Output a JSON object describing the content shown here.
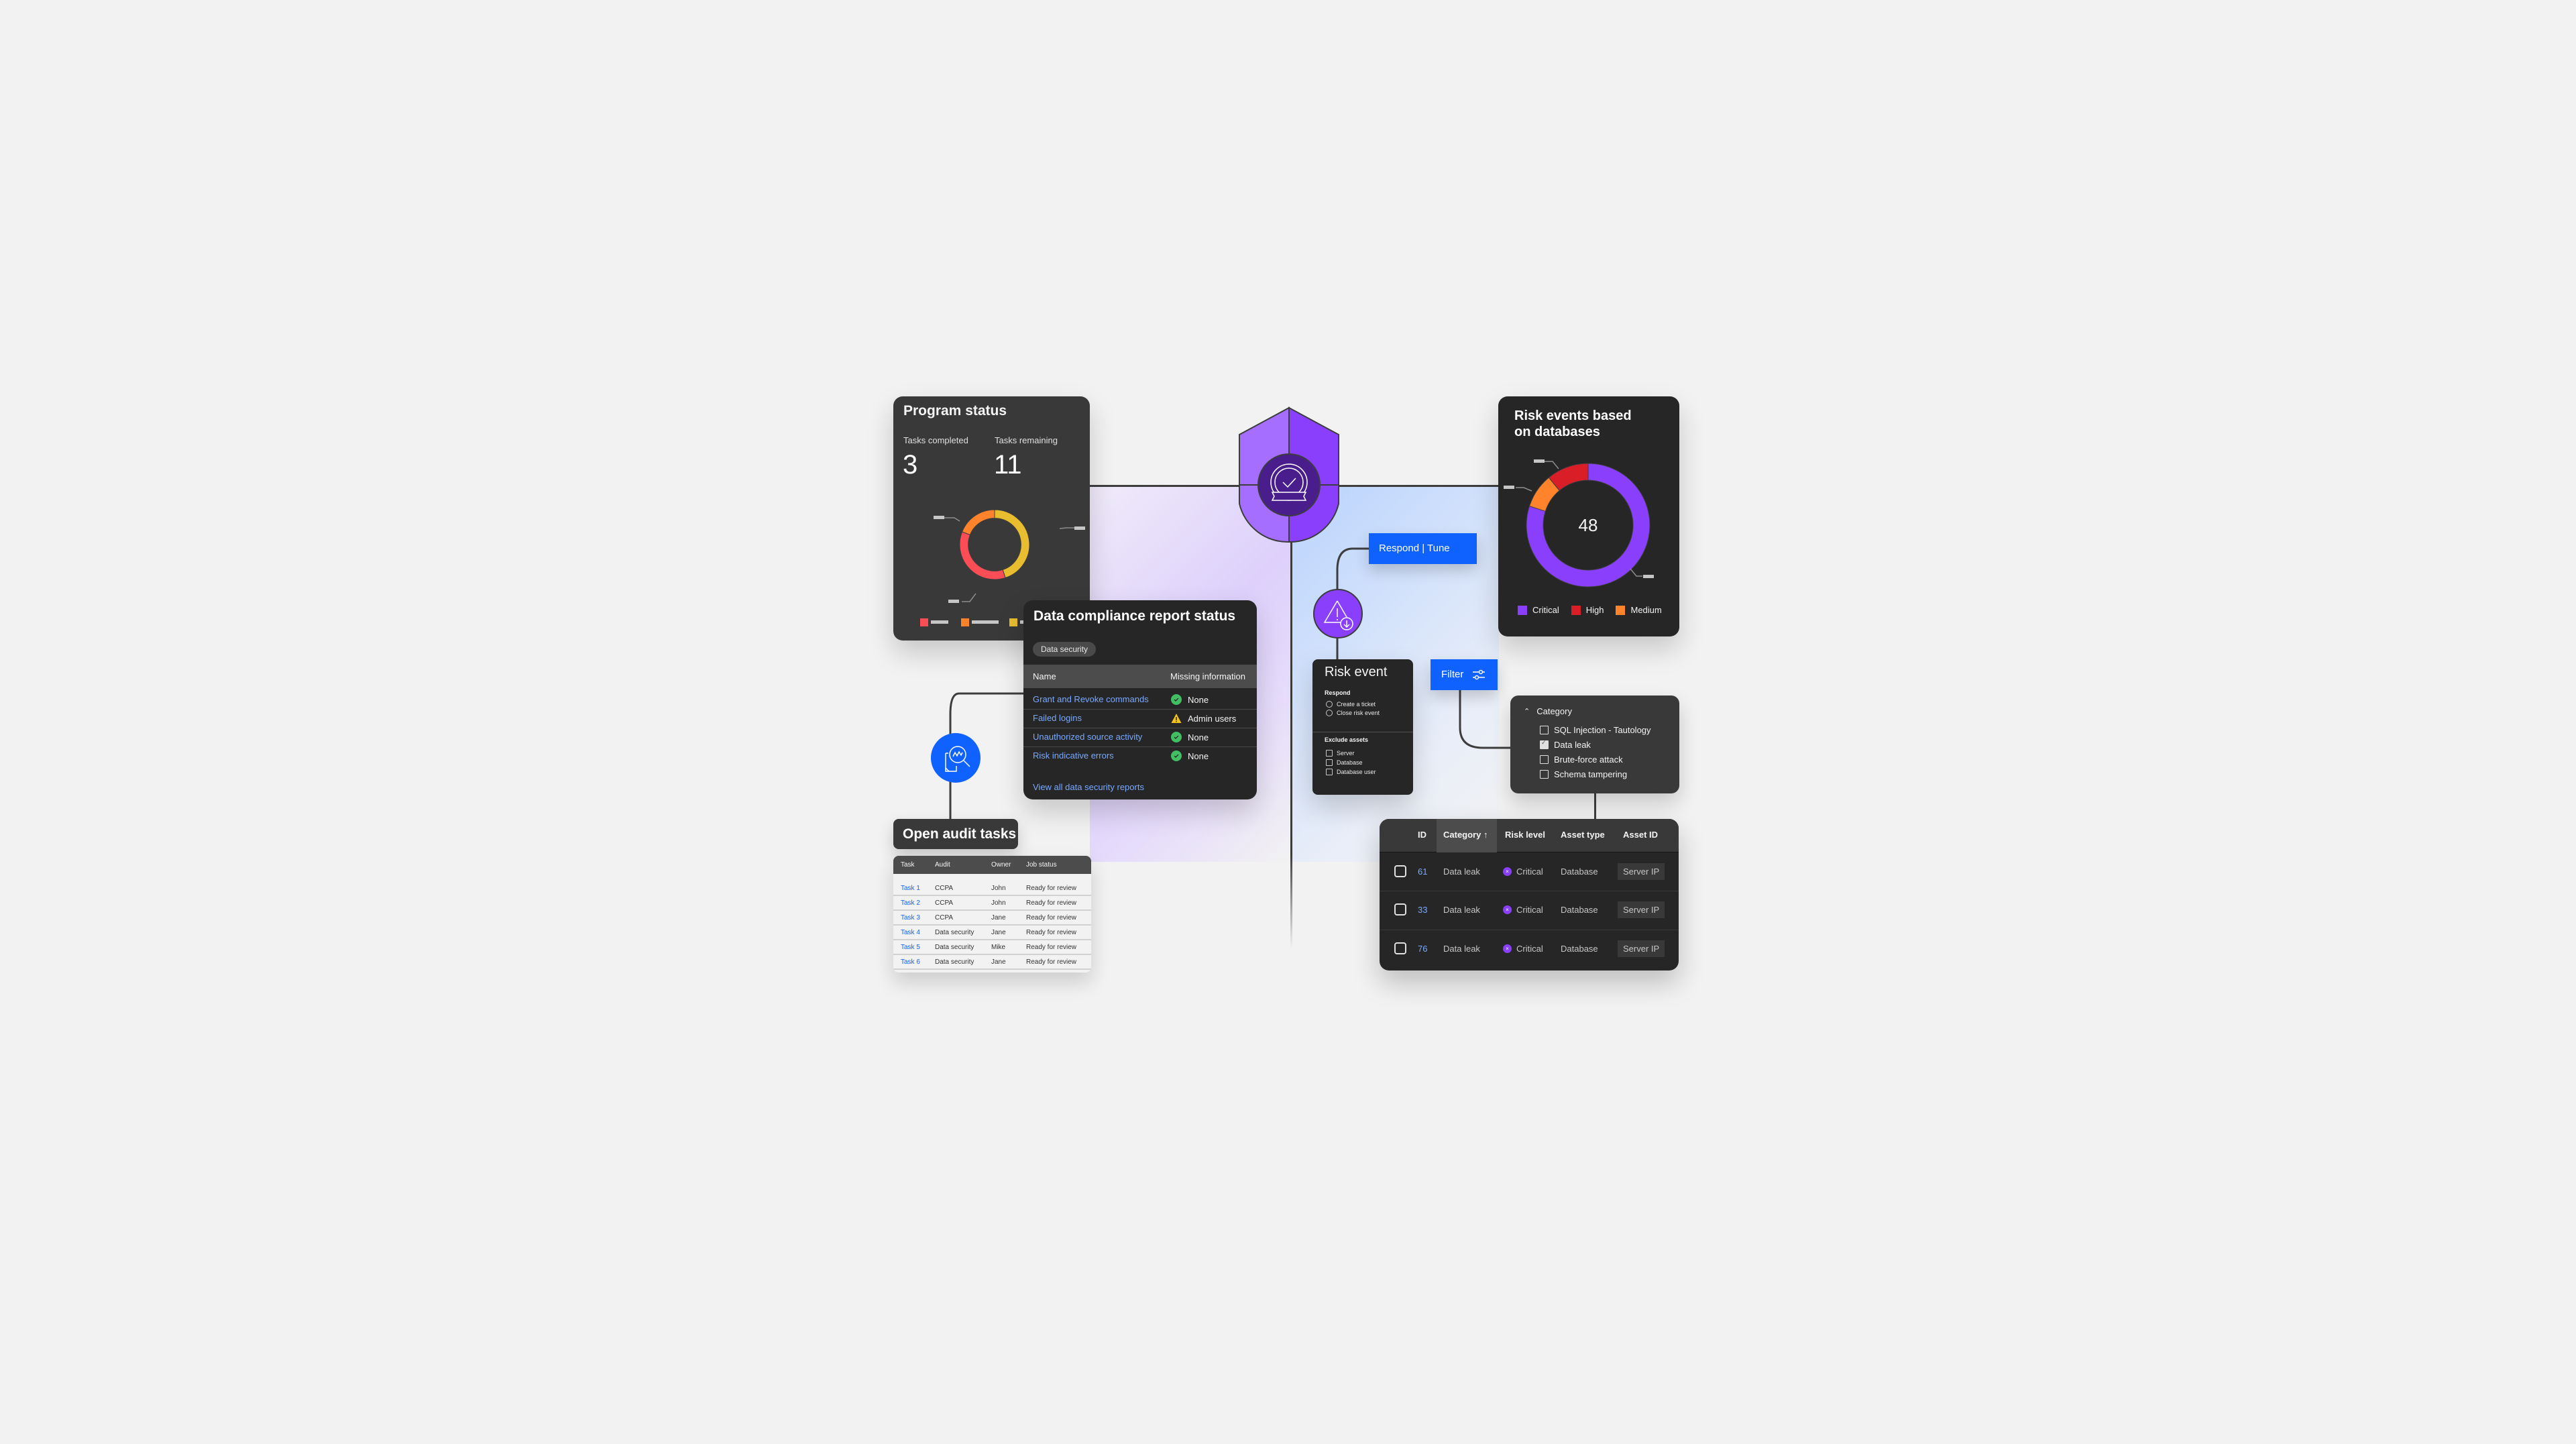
{
  "colors": {
    "background": "#f2f2f2",
    "accent_blue": "#0f62fe",
    "accent_purple": "#8a3ffc",
    "link_blue": "#78a9ff",
    "success_green": "#42be65",
    "warning_yellow": "#f1c21b"
  },
  "program_status": {
    "title": "Program status",
    "tasks_completed_label": "Tasks completed",
    "tasks_completed_value": "3",
    "tasks_remaining_label": "Tasks remaining",
    "tasks_remaining_value": "11"
  },
  "compliance": {
    "title": "Data compliance report status",
    "tag": "Data security",
    "columns": [
      "Name",
      "Missing information"
    ],
    "rows": [
      {
        "name": "Grant and Revoke commands",
        "status": "None",
        "icon": "check-circle-icon"
      },
      {
        "name": "Failed logins",
        "status": "Admin users",
        "icon": "warning-icon"
      },
      {
        "name": "Unauthorized source activity",
        "status": "None",
        "icon": "check-circle-icon"
      },
      {
        "name": "Risk indicative errors",
        "status": "None",
        "icon": "check-circle-icon"
      }
    ],
    "link": "View all data security reports"
  },
  "audit": {
    "title": "Open audit tasks",
    "columns": [
      "Task",
      "Audit",
      "Owner",
      "Job status"
    ],
    "rows": [
      {
        "task": "Task 1",
        "audit": "CCPA",
        "owner": "John",
        "status": "Ready for review"
      },
      {
        "task": "Task 2",
        "audit": "CCPA",
        "owner": "John",
        "status": "Ready for review"
      },
      {
        "task": "Task 3",
        "audit": "CCPA",
        "owner": "Jane",
        "status": "Ready for review"
      },
      {
        "task": "Task 4",
        "audit": "Data security",
        "owner": "Jane",
        "status": "Ready for review"
      },
      {
        "task": "Task 5",
        "audit": "Data security",
        "owner": "Mike",
        "status": "Ready for review"
      },
      {
        "task": "Task 6",
        "audit": "Data security",
        "owner": "Jane",
        "status": "Ready for review"
      }
    ]
  },
  "respond_button": "Respond | Tune",
  "risk_event": {
    "title": "Risk event",
    "respond_label": "Respond",
    "respond_options": [
      "Create a ticket",
      "Close risk event"
    ],
    "exclude_label": "Exclude assets",
    "exclude_options": [
      "Server",
      "Database",
      "Database user"
    ]
  },
  "filter": {
    "button_label": "Filter",
    "category_label": "Category",
    "options": [
      {
        "label": "SQL Injection - Tautology",
        "checked": false
      },
      {
        "label": "Data leak",
        "checked": true
      },
      {
        "label": "Brute-force attack",
        "checked": false
      },
      {
        "label": "Schema tampering",
        "checked": false
      }
    ]
  },
  "risk_table": {
    "columns": [
      "ID",
      "Category",
      "Risk level",
      "Asset type",
      "Asset ID"
    ],
    "sorted_column": "Category",
    "rows": [
      {
        "id": "61",
        "category": "Data leak",
        "risk": "Critical",
        "asset_type": "Database",
        "asset_id": "Server IP"
      },
      {
        "id": "33",
        "category": "Data leak",
        "risk": "Critical",
        "asset_type": "Database",
        "asset_id": "Server IP"
      },
      {
        "id": "76",
        "category": "Data leak",
        "risk": "Critical",
        "asset_type": "Database",
        "asset_id": "Server IP"
      }
    ]
  },
  "chart_data": [
    {
      "type": "pie",
      "title": "Program status",
      "donut": true,
      "categories": [
        "Red",
        "Orange",
        "Yellow"
      ],
      "values": [
        36,
        19,
        45
      ],
      "colors": [
        "#fa4d56",
        "#ff832b",
        "#e8bd2f"
      ],
      "legend": "bottom",
      "labels_redacted": true
    },
    {
      "type": "pie",
      "title": "Risk events based on databases",
      "donut": true,
      "center_label": "48",
      "categories": [
        "Critical",
        "High",
        "Medium"
      ],
      "values": [
        80,
        11,
        9
      ],
      "colors": [
        "#8a3ffc",
        "#da1e28",
        "#ff832b"
      ],
      "legend": "bottom"
    }
  ]
}
